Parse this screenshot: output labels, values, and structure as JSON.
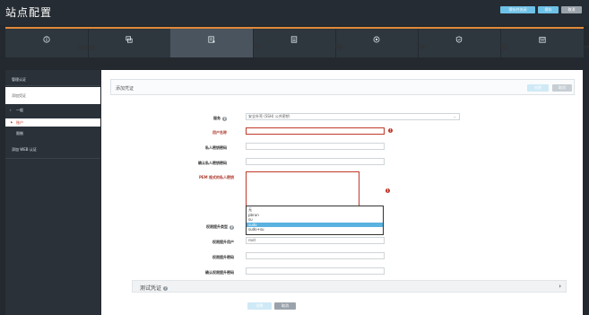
{
  "header": {
    "title": "站点配置",
    "buttons": [
      "保存并关闭",
      "保存",
      "取消"
    ]
  },
  "tabs": [
    {
      "label": "说明和安全",
      "icon": "info-icon"
    },
    {
      "label": "资产",
      "icon": "assets-icon"
    },
    {
      "label": "认证",
      "icon": "credentials-icon"
    },
    {
      "label": "模板",
      "icon": "template-icon"
    },
    {
      "label": "引擎",
      "icon": "engine-icon"
    },
    {
      "label": "警报",
      "icon": "alert-icon"
    },
    {
      "label": "计划",
      "icon": "schedule-icon"
    }
  ],
  "sidebar": {
    "items": [
      {
        "label": "管理认证"
      },
      {
        "label": "添加凭证"
      },
      {
        "label": "一般"
      },
      {
        "label": "账户"
      },
      {
        "label": "限制"
      },
      {
        "label": "添加 WEB 认证"
      }
    ]
  },
  "panel": {
    "title": "添加凭证",
    "header_buttons": [
      "创建",
      "取消"
    ],
    "fields": {
      "service_label": "服务",
      "service_value": "安全外壳 (SSH) 公共密钥",
      "username_label": "用户名称",
      "passphrase_label": "私人密钥密码",
      "confirm_passphrase_label": "确认私人密钥密码",
      "pem_label": "PEM 格式的私人密钥",
      "elevation_type_label": "权限提升类型",
      "elevation_user_label": "权限提升用户",
      "elevation_user_value": "root",
      "elevation_password_label": "权限提升密码",
      "confirm_elevation_password_label": "确认权限提升密码"
    },
    "dropdown_options": [
      {
        "label": "无",
        "selected": false
      },
      {
        "label": "pbrun",
        "selected": false
      },
      {
        "label": "su",
        "selected": false
      },
      {
        "label": "sudo",
        "selected": true
      },
      {
        "label": "sudo+su",
        "selected": false
      }
    ],
    "test_section": "测试凭证",
    "footer_buttons": [
      "创建",
      "取消"
    ]
  },
  "colors": {
    "accent_orange": "#e08a3a",
    "primary_blue": "#6fc2e7",
    "selection_blue": "#5ab2e0",
    "error_red": "#c0392b"
  }
}
